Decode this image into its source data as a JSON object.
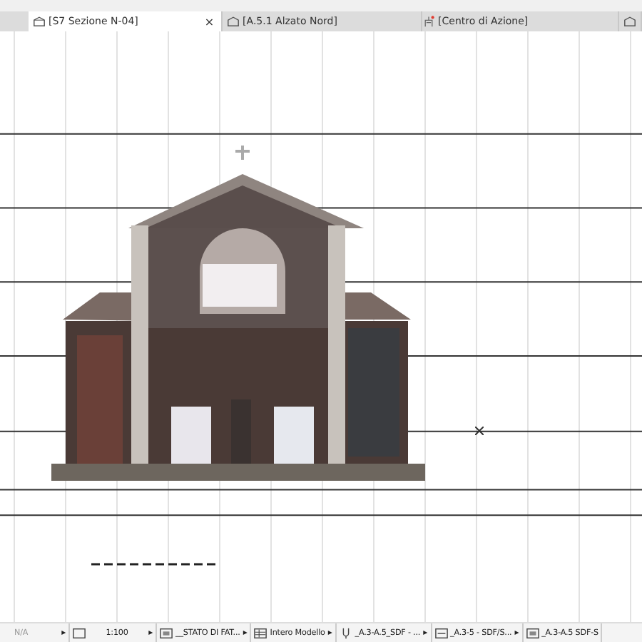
{
  "tabs": [
    {
      "kind": "section",
      "label": "[S7 Sezione N-04]",
      "selected": true,
      "close": "×"
    },
    {
      "kind": "elevation",
      "label": "[A.5.1 Alzato Nord]",
      "selected": false
    },
    {
      "kind": "marker",
      "label": "[Centro di Azione]",
      "selected": false
    },
    {
      "kind": "elevation",
      "selected": false
    }
  ],
  "status_bar": [
    {
      "kind": "text",
      "text": "N/A",
      "arrow": "▸"
    },
    {
      "kind": "scale",
      "text": "1:100",
      "arrow": "▸"
    },
    {
      "kind": "layers",
      "text": "__STATO DI FAT...",
      "arrow": "▸"
    },
    {
      "kind": "model",
      "text": "Intero Modello",
      "arrow": "▸"
    },
    {
      "kind": "pen",
      "text": "_A.3-A.5_SDF - ...",
      "arrow": "▸"
    },
    {
      "kind": "display",
      "text": "_A.3-5 - SDF/S...",
      "arrow": "▸"
    },
    {
      "kind": "copy",
      "text": "_A.3-A.5 SDF-S"
    }
  ]
}
